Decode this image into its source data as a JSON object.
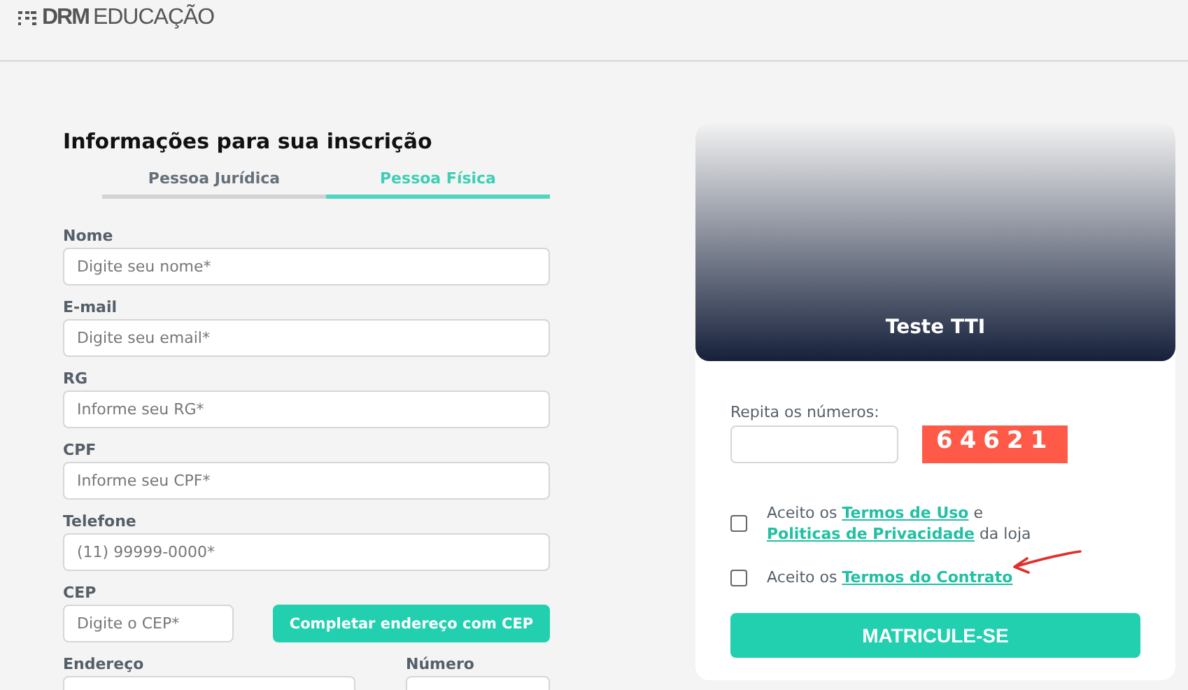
{
  "header": {
    "logo_bold": "DRM",
    "logo_light": "EDUCAÇÃO"
  },
  "form": {
    "title": "Informações para sua inscrição",
    "tabs": [
      {
        "label": "Pessoa Jurídica",
        "selected": false
      },
      {
        "label": "Pessoa Física",
        "selected": true
      }
    ],
    "fields": [
      {
        "label": "Nome",
        "placeholder": "Digite seu nome*"
      },
      {
        "label": "E-mail",
        "placeholder": "Digite seu email*"
      },
      {
        "label": "RG",
        "placeholder": "Informe seu RG*"
      },
      {
        "label": "CPF",
        "placeholder": "Informe seu CPF*"
      },
      {
        "label": "Telefone",
        "placeholder": "(11) 99999-0000*"
      }
    ],
    "cep": {
      "label": "CEP",
      "placeholder": "Digite o CEP*",
      "button": "Completar endereço com CEP"
    },
    "address": {
      "label": "Endereço"
    },
    "number": {
      "label": "Número"
    }
  },
  "card": {
    "title": "Teste TTI",
    "captcha_label": "Repita os números:",
    "captcha_code": "64621",
    "terms": [
      {
        "checked": false,
        "segments": [
          {
            "kind": "text",
            "text": "Aceito os "
          },
          {
            "kind": "link",
            "text": "Termos de Uso"
          },
          {
            "kind": "text",
            "text": " e "
          },
          {
            "kind": "link",
            "text": "Politicas de Privacidade"
          },
          {
            "kind": "text",
            "text": " da loja"
          }
        ]
      },
      {
        "checked": false,
        "segments": [
          {
            "kind": "text",
            "text": "Aceito os "
          },
          {
            "kind": "link",
            "text": "Termos do Contrato"
          }
        ]
      }
    ],
    "submit": "MATRICULE-SE"
  }
}
